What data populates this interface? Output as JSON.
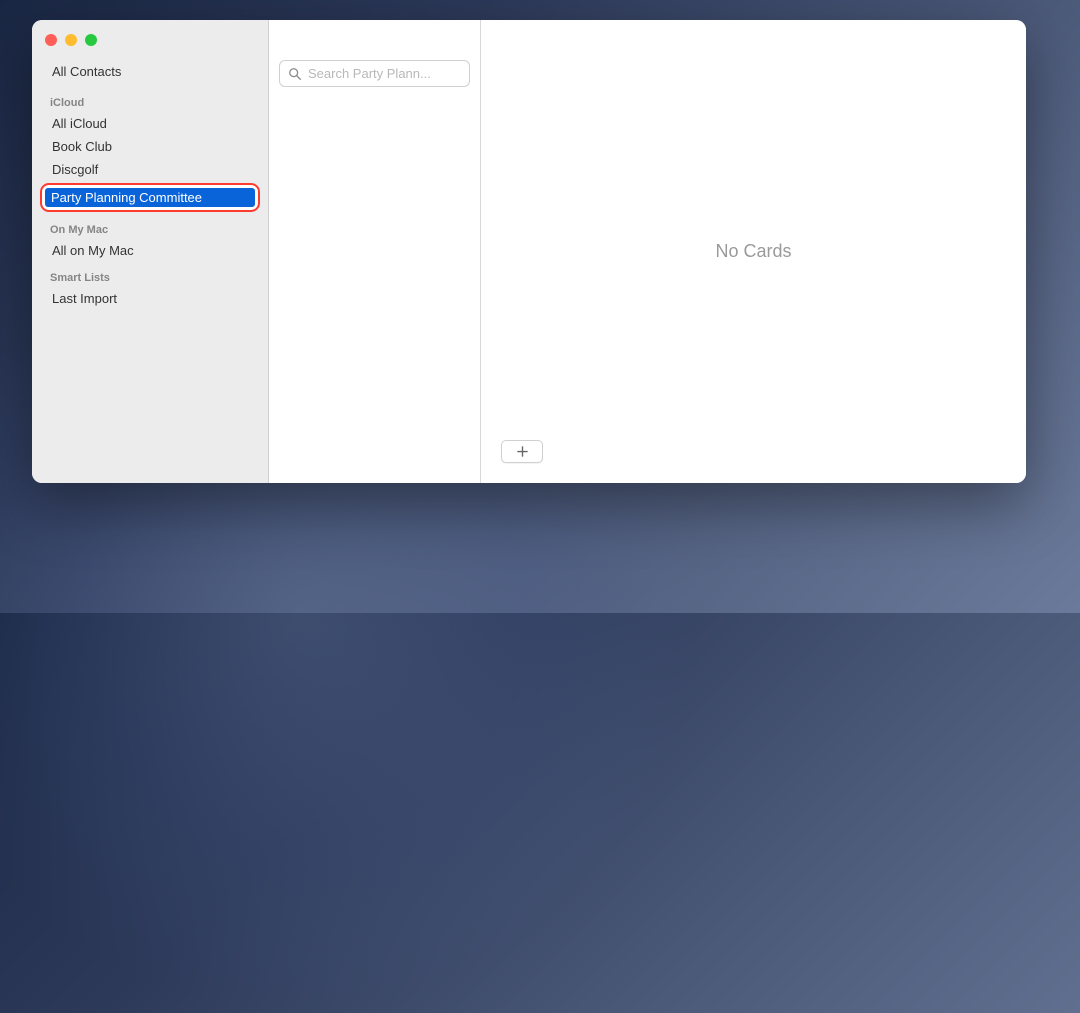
{
  "sidebar": {
    "allContacts": "All Contacts",
    "sections": [
      {
        "header": "iCloud",
        "items": [
          "All iCloud",
          "Book Club",
          "Discgolf"
        ],
        "editingItem": "Party Planning Committee"
      },
      {
        "header": "On My Mac",
        "items": [
          "All on My Mac"
        ]
      },
      {
        "header": "Smart Lists",
        "items": [
          "Last Import"
        ]
      }
    ]
  },
  "search": {
    "placeholder": "Search Party Plann..."
  },
  "detail": {
    "emptyMessage": "No Cards"
  }
}
